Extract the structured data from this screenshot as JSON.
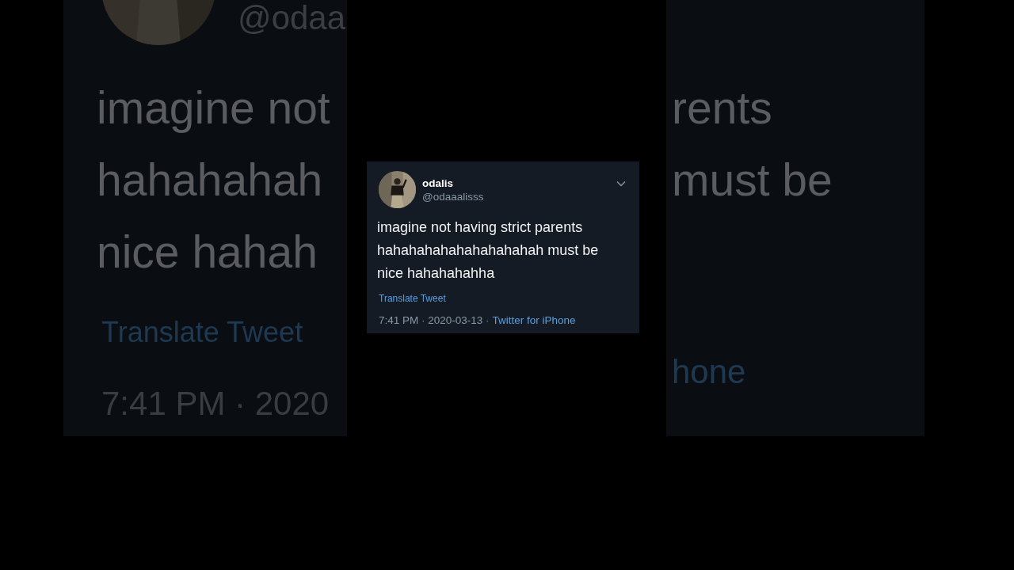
{
  "background_copy": {
    "left": {
      "handle": "@odaa",
      "lines": [
        "imagine not",
        "hahahahah",
        "nice hahah"
      ],
      "translate": "Translate Tweet",
      "timestamp": "7:41 PM · 2020"
    },
    "right": {
      "lines": [
        "rents",
        "must be"
      ],
      "source": "hone"
    }
  },
  "tweet": {
    "display_name": "odalis",
    "handle": "@odaaalisss",
    "text_lines": [
      "imagine not having strict parents",
      "hahahahahahahahahahah must be",
      "nice hahahahahha"
    ],
    "translate_link": "Translate Tweet",
    "time_date": "7:41 PM · 2020-03-13 ·",
    "source": "Twitter for iPhone"
  }
}
